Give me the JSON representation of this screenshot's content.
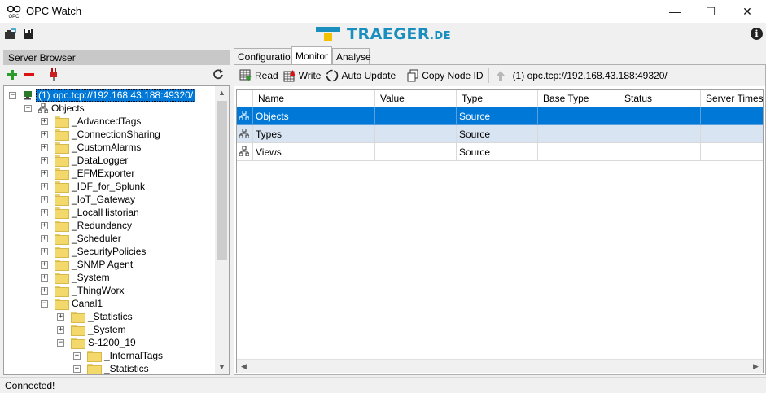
{
  "window": {
    "title": "OPC Watch",
    "minimize": "—",
    "maximize": "☐",
    "close": "✕"
  },
  "logo": {
    "text": "TRAEGER",
    "suffix": ".DE"
  },
  "server_browser": {
    "header": "Server Browser",
    "tree": [
      {
        "label": "(1) opc.tcp://192.168.43.188:49320/",
        "level": 0,
        "expander": "−",
        "icon": "server-icon",
        "selected": true
      },
      {
        "label": "Objects",
        "level": 1,
        "expander": "−",
        "icon": "objects-icon"
      },
      {
        "label": "_AdvancedTags",
        "level": 2,
        "expander": "+",
        "icon": "folder-icon"
      },
      {
        "label": "_ConnectionSharing",
        "level": 2,
        "expander": "+",
        "icon": "folder-icon"
      },
      {
        "label": "_CustomAlarms",
        "level": 2,
        "expander": "+",
        "icon": "folder-icon"
      },
      {
        "label": "_DataLogger",
        "level": 2,
        "expander": "+",
        "icon": "folder-icon"
      },
      {
        "label": "_EFMExporter",
        "level": 2,
        "expander": "+",
        "icon": "folder-icon"
      },
      {
        "label": "_IDF_for_Splunk",
        "level": 2,
        "expander": "+",
        "icon": "folder-icon"
      },
      {
        "label": "_IoT_Gateway",
        "level": 2,
        "expander": "+",
        "icon": "folder-icon"
      },
      {
        "label": "_LocalHistorian",
        "level": 2,
        "expander": "+",
        "icon": "folder-icon"
      },
      {
        "label": "_Redundancy",
        "level": 2,
        "expander": "+",
        "icon": "folder-icon"
      },
      {
        "label": "_Scheduler",
        "level": 2,
        "expander": "+",
        "icon": "folder-icon"
      },
      {
        "label": "_SecurityPolicies",
        "level": 2,
        "expander": "+",
        "icon": "folder-icon"
      },
      {
        "label": "_SNMP Agent",
        "level": 2,
        "expander": "+",
        "icon": "folder-icon"
      },
      {
        "label": "_System",
        "level": 2,
        "expander": "+",
        "icon": "folder-icon"
      },
      {
        "label": "_ThingWorx",
        "level": 2,
        "expander": "+",
        "icon": "folder-icon"
      },
      {
        "label": "Canal1",
        "level": 2,
        "expander": "−",
        "icon": "folder-icon"
      },
      {
        "label": "_Statistics",
        "level": 3,
        "expander": "+",
        "icon": "folder-icon"
      },
      {
        "label": "_System",
        "level": 3,
        "expander": "+",
        "icon": "folder-icon"
      },
      {
        "label": "S-1200_19",
        "level": 3,
        "expander": "−",
        "icon": "folder-icon"
      },
      {
        "label": "_InternalTags",
        "level": 4,
        "expander": "+",
        "icon": "folder-icon"
      },
      {
        "label": "_Statistics",
        "level": 4,
        "expander": "+",
        "icon": "folder-icon"
      }
    ]
  },
  "tabs": [
    {
      "label": "Configuration",
      "active": false
    },
    {
      "label": "Monitor",
      "active": true
    },
    {
      "label": "Analyse",
      "active": false
    }
  ],
  "monitor_toolbar": {
    "read": "Read",
    "write": "Write",
    "auto_update": "Auto Update",
    "copy_node_id": "Copy Node ID",
    "path": "(1) opc.tcp://192.168.43.188:49320/"
  },
  "grid": {
    "columns": [
      "Name",
      "Value",
      "Type",
      "Base Type",
      "Status",
      "Server Timestamp"
    ],
    "rows": [
      {
        "name": "Objects",
        "value": "",
        "type": "Source",
        "base_type": "",
        "status": "",
        "server_timestamp": "",
        "selected": true
      },
      {
        "name": "Types",
        "value": "",
        "type": "Source",
        "base_type": "",
        "status": "",
        "server_timestamp": "",
        "alt": true
      },
      {
        "name": "Views",
        "value": "",
        "type": "Source",
        "base_type": "",
        "status": "",
        "server_timestamp": ""
      }
    ]
  },
  "status_bar": {
    "text": "Connected!"
  },
  "colors": {
    "selection": "#0078d7",
    "logo_blue": "#1a8fbf",
    "logo_yellow": "#f2c200",
    "add_green": "#2a9d2a",
    "remove_red": "#d11"
  }
}
